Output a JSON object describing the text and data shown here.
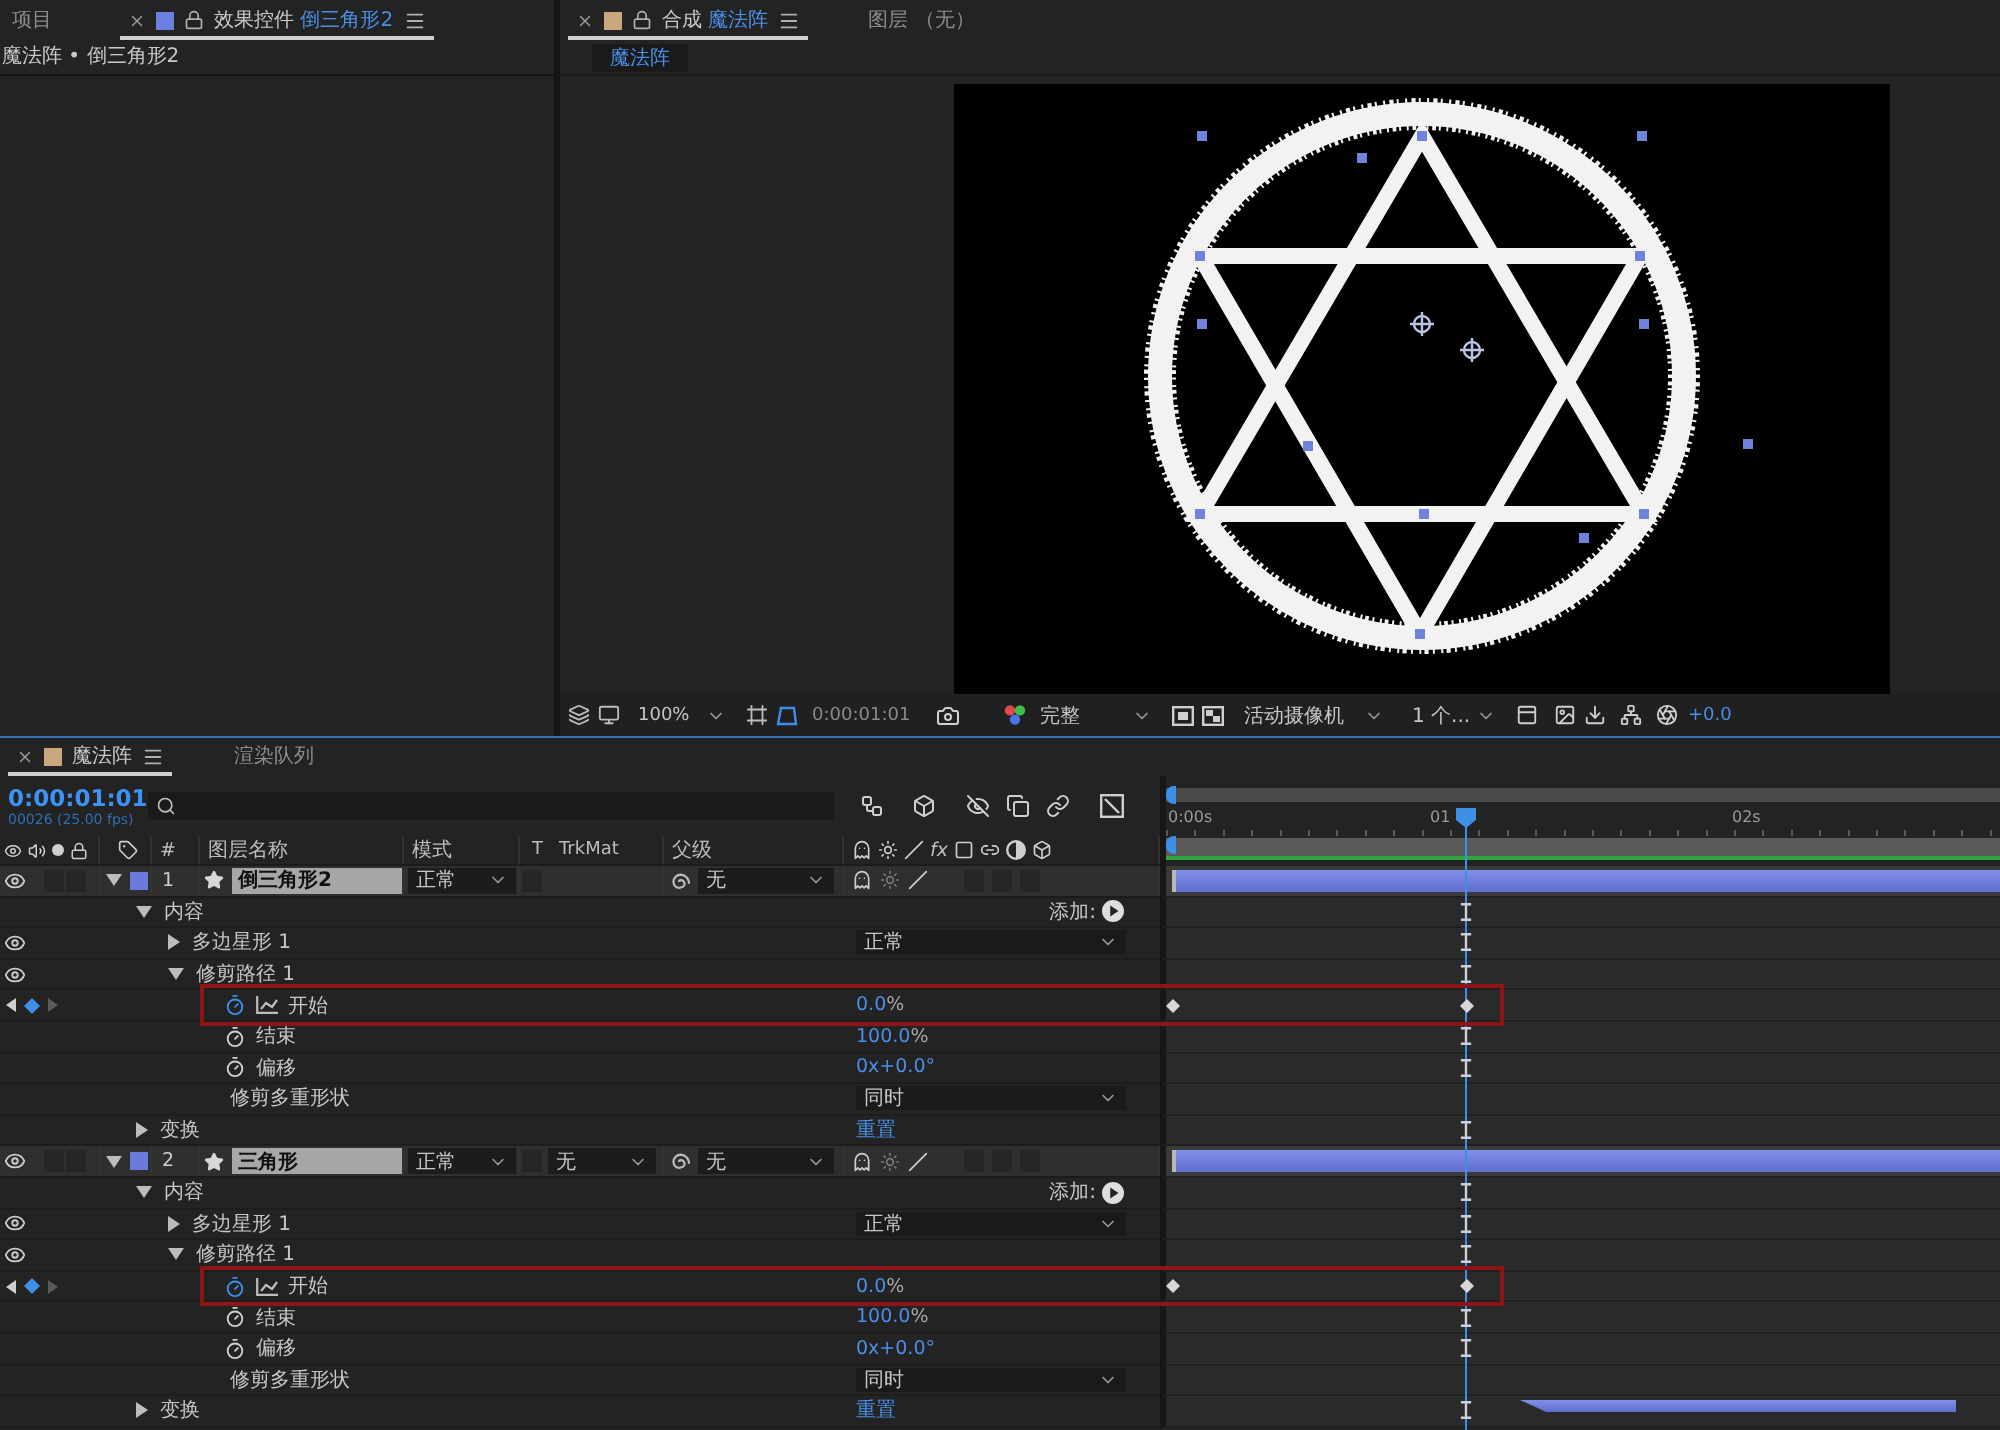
{
  "left_panel": {
    "tabs": [
      {
        "label": "项目",
        "selected": false
      },
      {
        "label": "效果控件",
        "target": "倒三角形2",
        "color": "#6b7fe0",
        "selected": true
      }
    ],
    "breadcrumb": "魔法阵 • 倒三角形2"
  },
  "composition_panel": {
    "tabs": [
      {
        "label": "合成",
        "target": "魔法阵",
        "color": "#c8a87c",
        "selected": true
      },
      {
        "label": "图层 （无）",
        "selected": false
      }
    ],
    "viewer_tabs": [
      {
        "label": "魔法阵",
        "selected": true
      }
    ],
    "toolbar": {
      "zoom": "100%",
      "time": "0:00:01:01",
      "resolution": "完整",
      "camera": "活动摄像机",
      "views": "1 个...",
      "exposure": "+0.0"
    }
  },
  "timeline": {
    "tabs": [
      {
        "label": "魔法阵",
        "color": "#c8a87c",
        "selected": true
      },
      {
        "label": "渲染队列",
        "selected": false
      }
    ],
    "timecode": "0:00:01:01",
    "frame_info": "00026 (25.00 fps)",
    "ruler": [
      "0:00s",
      "01",
      "02s"
    ],
    "columns": {
      "number": "#",
      "layer_name": "图层名称",
      "mode": "模式",
      "t": "T",
      "trkmat": "TrkMat",
      "parent": "父级",
      "fx": "fx"
    },
    "layers": [
      {
        "index": "1",
        "name": "倒三角形2",
        "mode": "正常",
        "parent": "无",
        "visible": true,
        "expanded": true,
        "children": [
          {
            "kind": "group",
            "name": "内容",
            "expanded": true,
            "action": "添加:",
            "children": [
              {
                "kind": "shape",
                "name": "多边星形 1",
                "visible": true,
                "expanded": false,
                "mode": "正常"
              },
              {
                "kind": "shape",
                "name": "修剪路径 1",
                "visible": true,
                "expanded": true,
                "children": [
                  {
                    "kind": "property",
                    "name": "开始",
                    "value": "0.0",
                    "unit": "%",
                    "keyframed": true,
                    "highlighted": true
                  },
                  {
                    "kind": "property",
                    "name": "结束",
                    "value": "100.0",
                    "unit": "%",
                    "keyframed": false
                  },
                  {
                    "kind": "property",
                    "name": "偏移",
                    "value": "0x+0.0°",
                    "keyframed": false
                  },
                  {
                    "kind": "option",
                    "name": "修剪多重形状",
                    "value": "同时"
                  }
                ]
              }
            ]
          },
          {
            "kind": "group",
            "name": "变换",
            "expanded": false,
            "link": "重置"
          }
        ]
      },
      {
        "index": "2",
        "name": "三角形",
        "mode": "正常",
        "trkmat": "无",
        "parent": "无",
        "visible": true,
        "expanded": true,
        "children": [
          {
            "kind": "group",
            "name": "内容",
            "expanded": true,
            "action": "添加:",
            "children": [
              {
                "kind": "shape",
                "name": "多边星形 1",
                "visible": true,
                "expanded": false,
                "mode": "正常"
              },
              {
                "kind": "shape",
                "name": "修剪路径 1",
                "visible": true,
                "expanded": true,
                "children": [
                  {
                    "kind": "property",
                    "name": "开始",
                    "value": "0.0",
                    "unit": "%",
                    "keyframed": true,
                    "highlighted": true
                  },
                  {
                    "kind": "property",
                    "name": "结束",
                    "value": "100.0",
                    "unit": "%",
                    "keyframed": false
                  },
                  {
                    "kind": "property",
                    "name": "偏移",
                    "value": "0x+0.0°",
                    "keyframed": false
                  },
                  {
                    "kind": "option",
                    "name": "修剪多重形状",
                    "value": "同时"
                  }
                ]
              }
            ]
          },
          {
            "kind": "group",
            "name": "变换",
            "expanded": false,
            "link": "重置"
          }
        ]
      }
    ]
  }
}
